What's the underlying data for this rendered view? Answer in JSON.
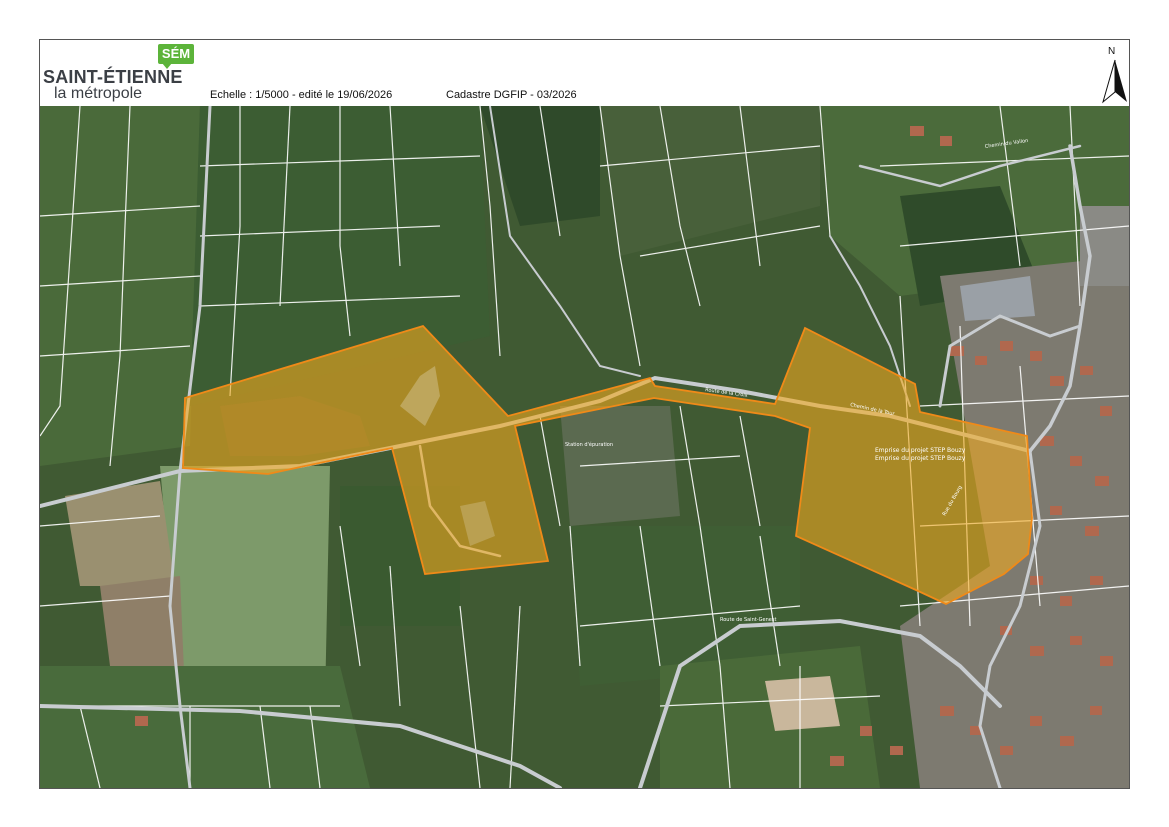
{
  "header": {
    "logo_badge": "SÉM",
    "logo_main": "SAINT-ÉTIENNE",
    "logo_sub": "la métropole",
    "scale_text": "Echelle : 1/5000 - edité le 19/06/2026",
    "cadastre_text": "Cadastre DGFIP - 03/2026",
    "north_label": "N"
  },
  "map": {
    "zone_color": "#f0a81e",
    "zone_stroke": "#f08a18",
    "road_color": "#c8ccd0",
    "parcel_color": "#ffffff",
    "zone_label_1": "Emprise du projet STEP Bouzy",
    "zone_label_2": "Emprise du projet STEP Bouzy",
    "road_labels": [
      "Route de la Croix",
      "Chemin de la Tour",
      "Rue du Bourg",
      "Route de Saint-Genest",
      "Chemin du Vallon"
    ],
    "area_label": "Station d'épuration"
  }
}
